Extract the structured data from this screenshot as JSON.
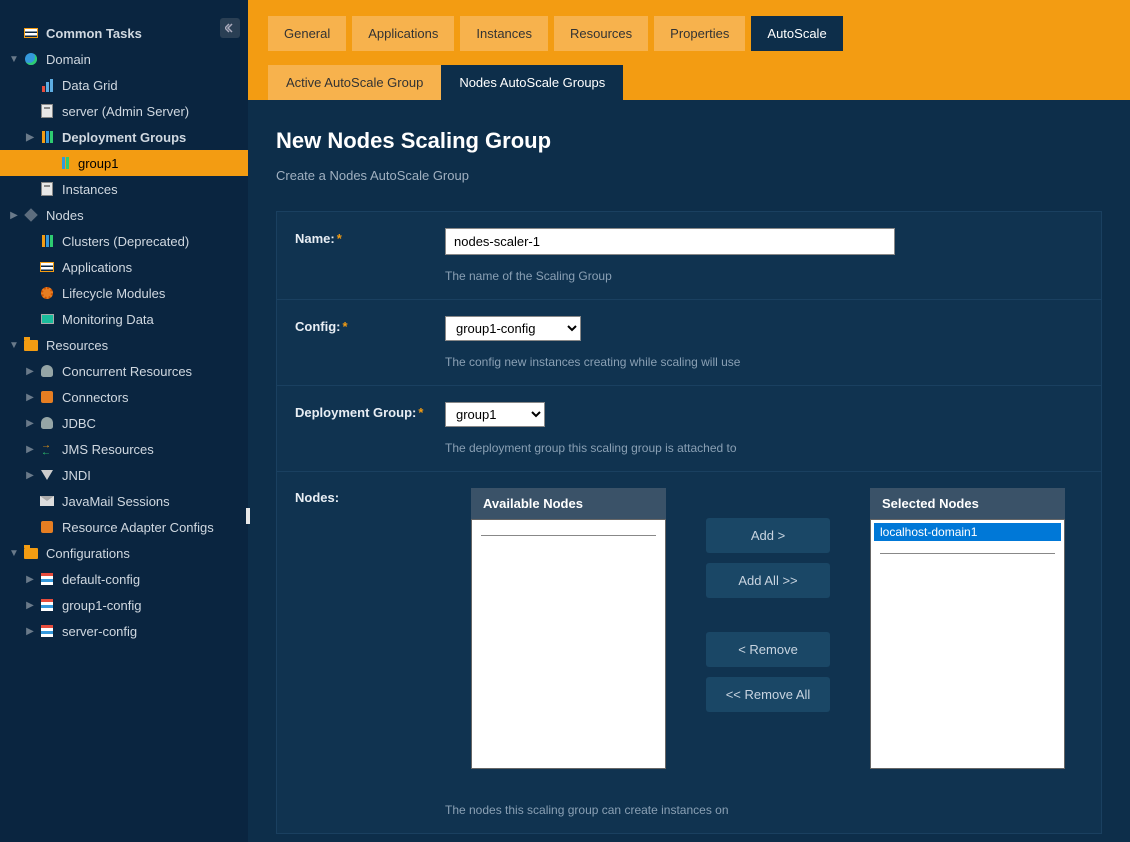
{
  "sidebar": {
    "items": [
      {
        "label": "Common Tasks",
        "indent": 0,
        "toggle": "",
        "icon": "list",
        "bold": true
      },
      {
        "label": "Domain",
        "indent": 0,
        "toggle": "▼",
        "icon": "globe",
        "bold": false
      },
      {
        "label": "Data Grid",
        "indent": 1,
        "toggle": "",
        "icon": "bars",
        "bold": false
      },
      {
        "label": "server (Admin Server)",
        "indent": 1,
        "toggle": "",
        "icon": "server",
        "bold": false
      },
      {
        "label": "Deployment Groups",
        "indent": 1,
        "toggle": "▶",
        "icon": "dg",
        "bold": true
      },
      {
        "label": "group1",
        "indent": 2,
        "toggle": "",
        "icon": "dg",
        "bold": false,
        "selected": true
      },
      {
        "label": "Instances",
        "indent": 1,
        "toggle": "",
        "icon": "server",
        "bold": false
      },
      {
        "label": "Nodes",
        "indent": 0,
        "toggle": "▶",
        "icon": "cube",
        "bold": false
      },
      {
        "label": "Clusters (Deprecated)",
        "indent": 1,
        "toggle": "",
        "icon": "dg",
        "bold": false
      },
      {
        "label": "Applications",
        "indent": 1,
        "toggle": "",
        "icon": "list",
        "bold": false
      },
      {
        "label": "Lifecycle Modules",
        "indent": 1,
        "toggle": "",
        "icon": "gear",
        "bold": false
      },
      {
        "label": "Monitoring Data",
        "indent": 1,
        "toggle": "",
        "icon": "monitor",
        "bold": false
      },
      {
        "label": "Resources",
        "indent": 0,
        "toggle": "▼",
        "icon": "folder",
        "bold": false
      },
      {
        "label": "Concurrent Resources",
        "indent": 1,
        "toggle": "▶",
        "icon": "db",
        "bold": false
      },
      {
        "label": "Connectors",
        "indent": 1,
        "toggle": "▶",
        "icon": "plug",
        "bold": false
      },
      {
        "label": "JDBC",
        "indent": 1,
        "toggle": "▶",
        "icon": "db",
        "bold": false
      },
      {
        "label": "JMS Resources",
        "indent": 1,
        "toggle": "▶",
        "icon": "arrows",
        "bold": false
      },
      {
        "label": "JNDI",
        "indent": 1,
        "toggle": "▶",
        "icon": "funnel",
        "bold": false
      },
      {
        "label": "JavaMail Sessions",
        "indent": 1,
        "toggle": "",
        "icon": "mail",
        "bold": false
      },
      {
        "label": "Resource Adapter Configs",
        "indent": 1,
        "toggle": "",
        "icon": "plug",
        "bold": false
      },
      {
        "label": "Configurations",
        "indent": 0,
        "toggle": "▼",
        "icon": "folder",
        "bold": false
      },
      {
        "label": "default-config",
        "indent": 1,
        "toggle": "▶",
        "icon": "cfg",
        "bold": false
      },
      {
        "label": "group1-config",
        "indent": 1,
        "toggle": "▶",
        "icon": "cfg",
        "bold": false
      },
      {
        "label": "server-config",
        "indent": 1,
        "toggle": "▶",
        "icon": "cfg",
        "bold": false
      }
    ]
  },
  "tabs": {
    "primary": [
      {
        "label": "General",
        "active": false
      },
      {
        "label": "Applications",
        "active": false
      },
      {
        "label": "Instances",
        "active": false
      },
      {
        "label": "Resources",
        "active": false
      },
      {
        "label": "Properties",
        "active": false
      },
      {
        "label": "AutoScale",
        "active": true
      }
    ],
    "secondary": [
      {
        "label": "Active AutoScale Group",
        "active": false
      },
      {
        "label": "Nodes AutoScale Groups",
        "active": true
      }
    ]
  },
  "page": {
    "title": "New Nodes Scaling Group",
    "subtitle": "Create a Nodes AutoScale Group"
  },
  "form": {
    "name": {
      "label": "Name:",
      "value": "nodes-scaler-1",
      "hint": "The name of the Scaling Group"
    },
    "config": {
      "label": "Config:",
      "value": "group1-config",
      "hint": "The config new instances creating while scaling will use"
    },
    "dg": {
      "label": "Deployment Group:",
      "value": "group1",
      "hint": "The deployment group this scaling group is attached to"
    },
    "nodes": {
      "label": "Nodes:",
      "available_header": "Available Nodes",
      "available_items": [],
      "selected_header": "Selected Nodes",
      "selected_items": [
        {
          "label": "localhost-domain1",
          "selected": true
        }
      ],
      "hint": "The nodes this scaling group can create instances on"
    },
    "buttons": {
      "add": "Add >",
      "add_all": "Add All >>",
      "remove": "< Remove",
      "remove_all": "<< Remove All"
    }
  }
}
